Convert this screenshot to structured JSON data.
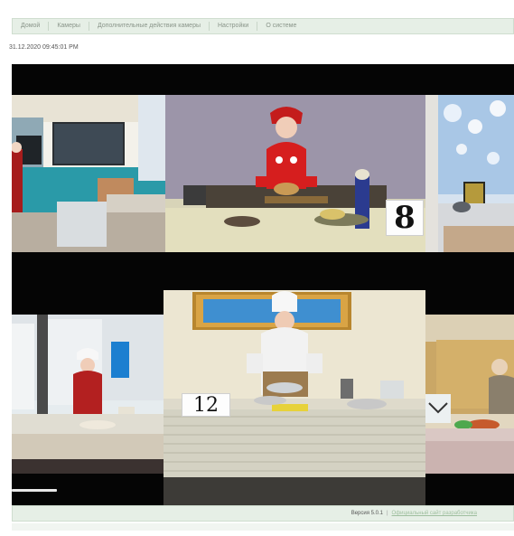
{
  "nav": {
    "items": [
      {
        "label": "Домой",
        "id": "home"
      },
      {
        "label": "Камеры",
        "id": "cameras"
      },
      {
        "label": "Дополнительные действия камеры",
        "id": "extra"
      },
      {
        "label": "Настройки",
        "id": "settings"
      },
      {
        "label": "О системе",
        "id": "about"
      }
    ]
  },
  "video": {
    "timestamp": "31.12.2020 09:45:01 PM",
    "tiles": [
      {
        "name": "camera-tile-top-left",
        "scene": "classroom"
      },
      {
        "name": "camera-tile-top-center",
        "scene": "girl-cooking",
        "number": "8"
      },
      {
        "name": "camera-tile-top-right",
        "scene": "decorated-room"
      },
      {
        "name": "camera-tile-bottom-left",
        "scene": "child-cooking"
      },
      {
        "name": "camera-tile-bottom-center",
        "scene": "boy-cooking",
        "number": "12"
      },
      {
        "name": "camera-tile-bottom-right",
        "scene": "child-cooking"
      }
    ],
    "playback_progress": 0.09
  },
  "footer": {
    "version": "Версия 5.0.1",
    "separator": "|",
    "link": "Официальный сайт разработчика"
  },
  "colors": {
    "bar_background": "#e6efe6",
    "stage_background": "#050505"
  }
}
